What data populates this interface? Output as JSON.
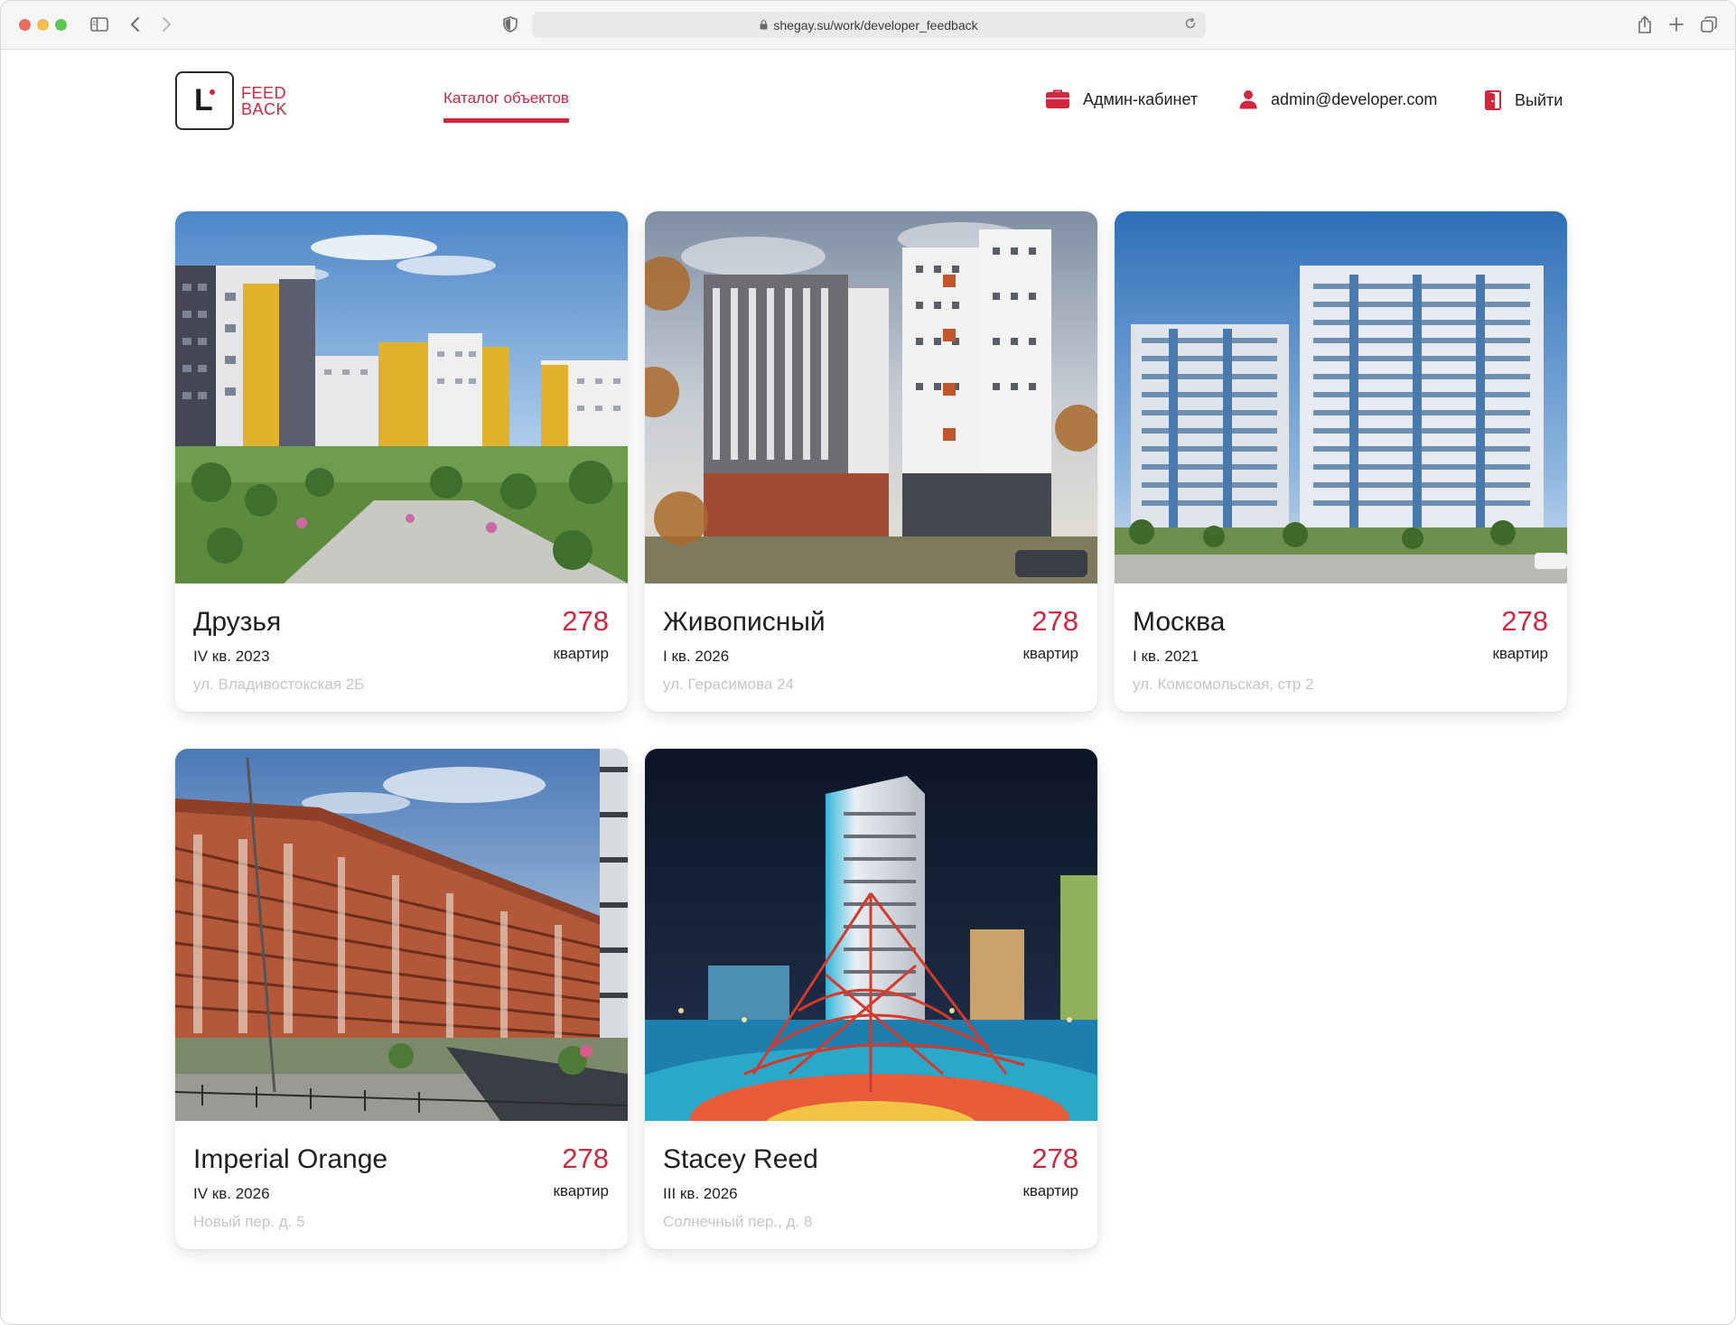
{
  "browser": {
    "url": "shegay.su/work/developer_feedback"
  },
  "header": {
    "logo_line1": "FEED",
    "logo_line2": "BACK",
    "logo_mark": "L",
    "nav_catalog": "Каталог объектов",
    "admin_cabinet": "Админ-кабинет",
    "user_email": "admin@developer.com",
    "logout": "Выйти"
  },
  "colors": {
    "accent": "#d0273e"
  },
  "cards": [
    {
      "name": "Друзья",
      "date": "IV кв. 2023",
      "address": "ул. Владивостокская 2Б",
      "count": "278",
      "unit": "квартир"
    },
    {
      "name": "Живописный",
      "date": "I кв. 2026",
      "address": "ул. Герасимова 24",
      "count": "278",
      "unit": "квартир"
    },
    {
      "name": "Москва",
      "date": "I кв. 2021",
      "address": "ул. Комсомольская, стр 2",
      "count": "278",
      "unit": "квартир"
    },
    {
      "name": "Imperial Orange",
      "date": "IV кв. 2026",
      "address": "Новый пер. д. 5",
      "count": "278",
      "unit": "квартир"
    },
    {
      "name": "Stacey Reed",
      "date": "III кв. 2026",
      "address": "Солнечный пер., д. 8",
      "count": "278",
      "unit": "квартир"
    }
  ]
}
